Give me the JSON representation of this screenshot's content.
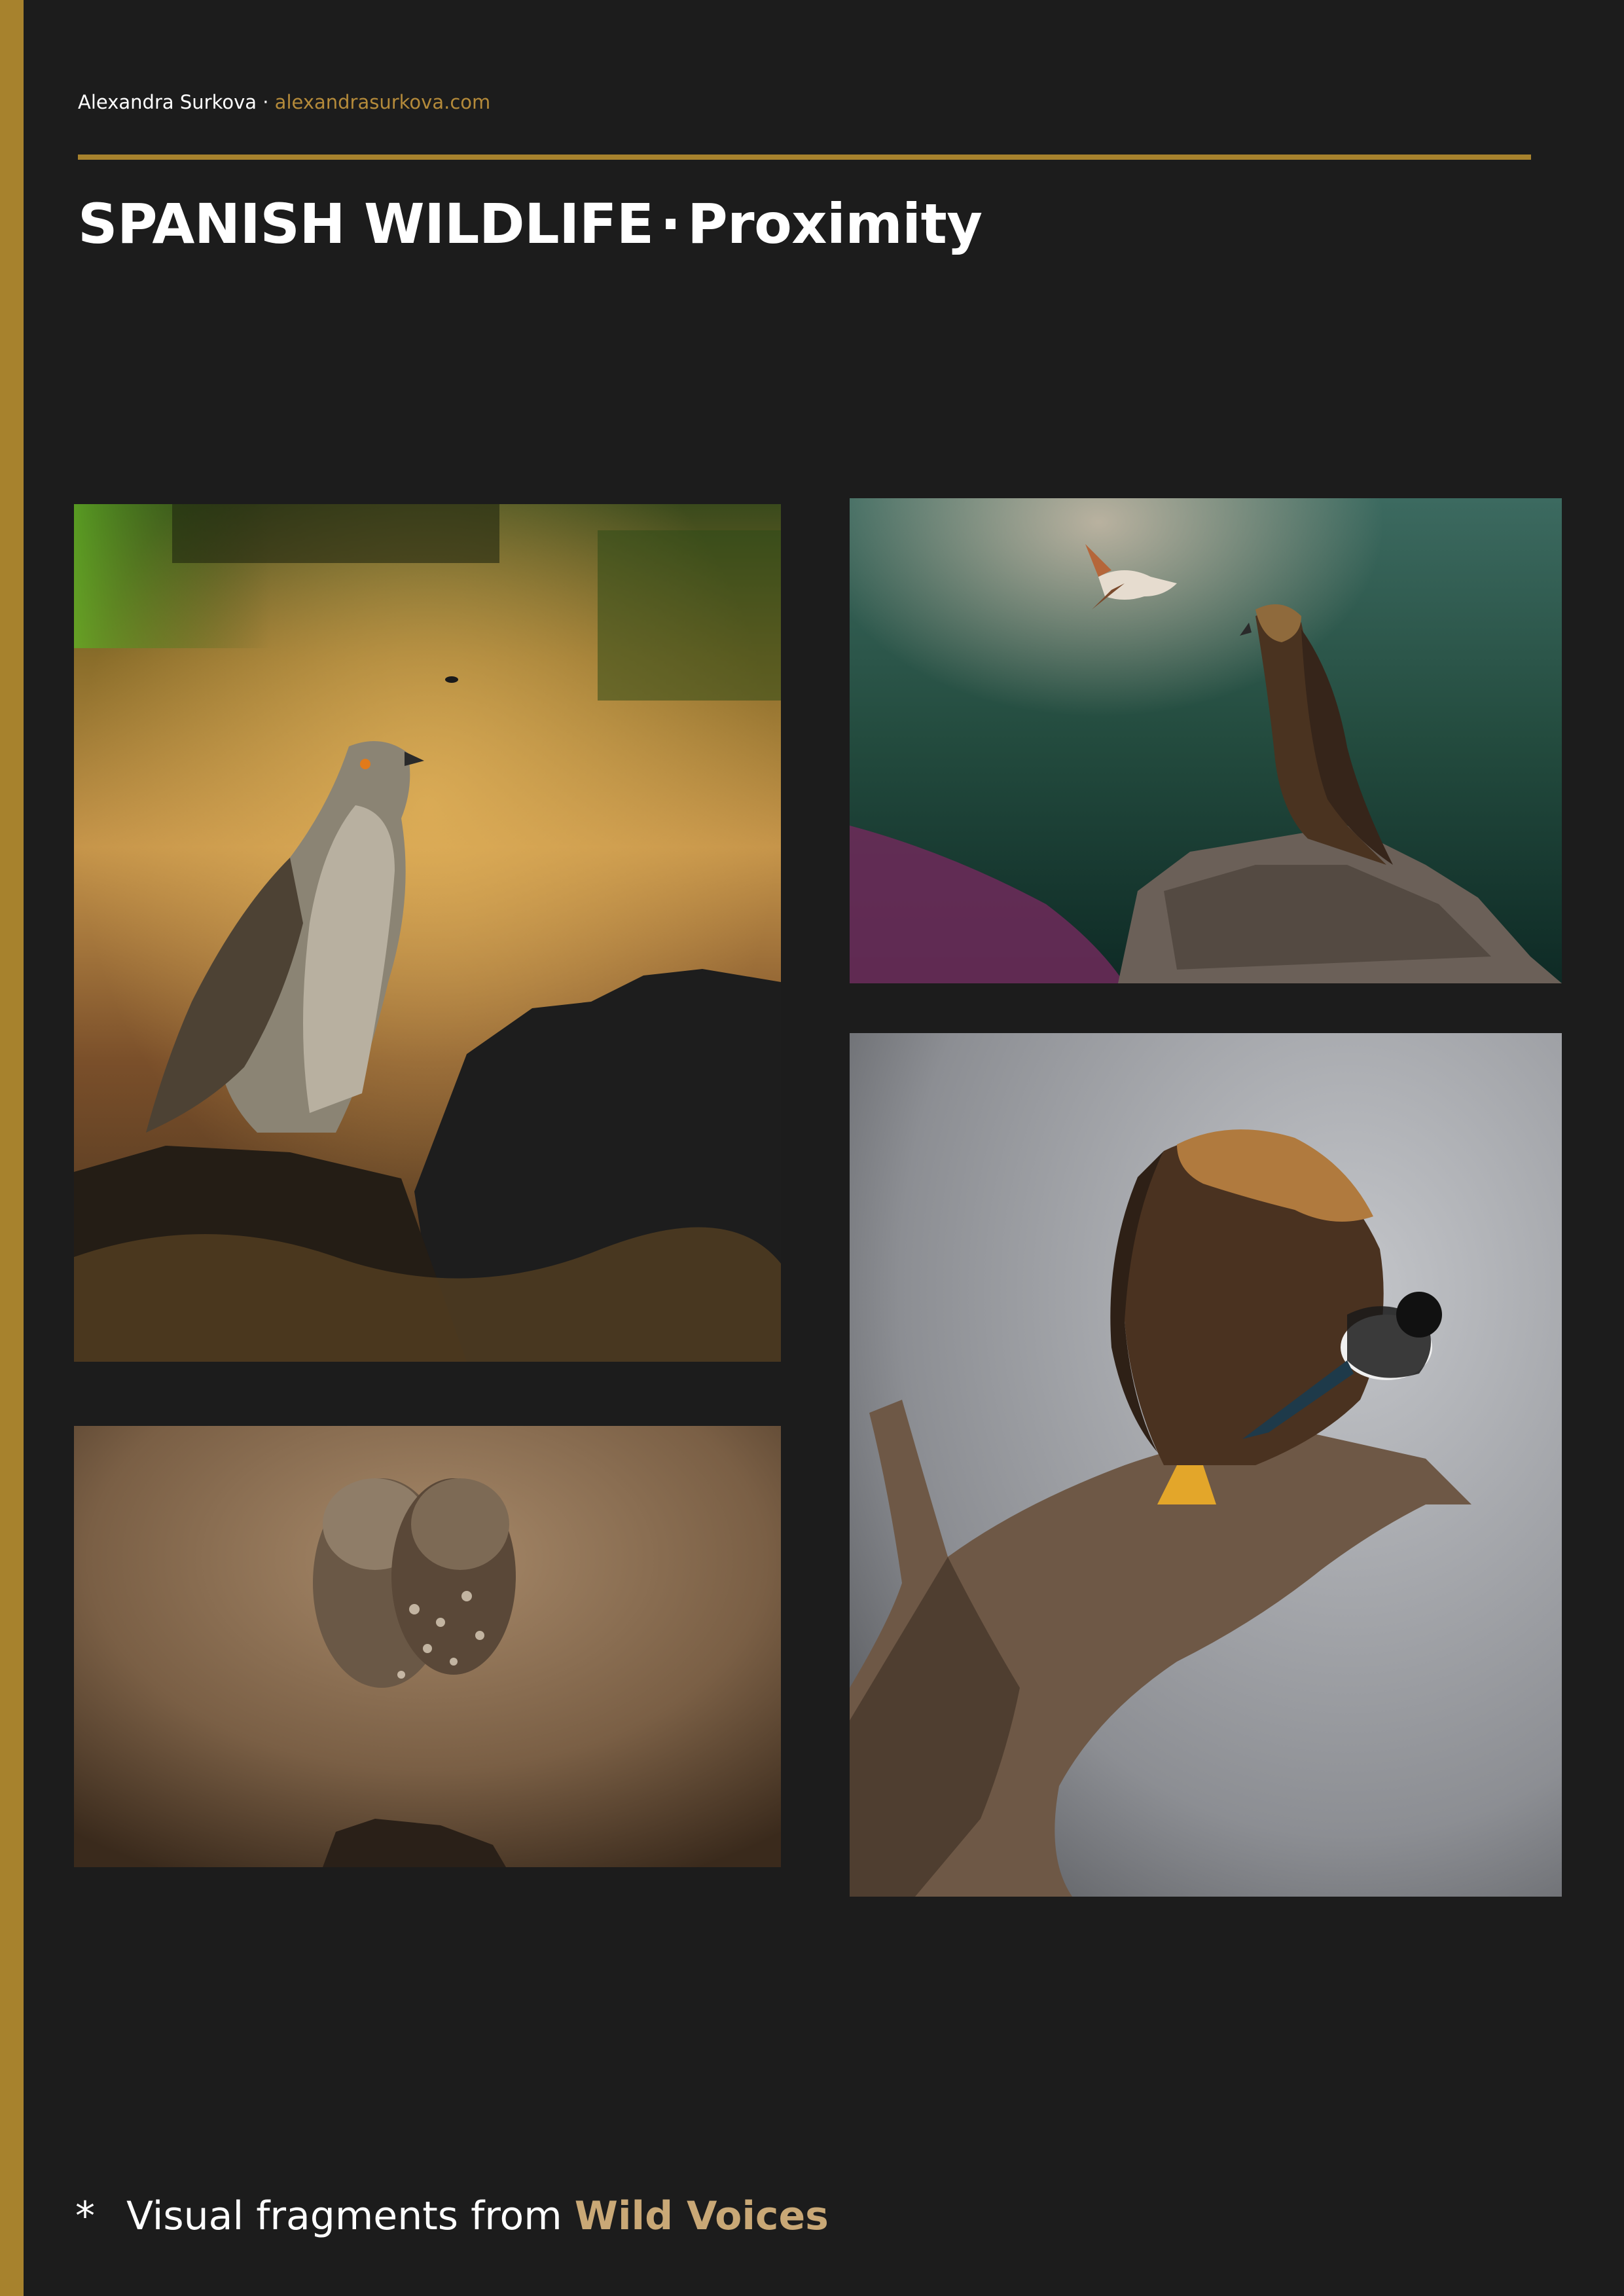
{
  "header": {
    "author": "Alexandra Surkova",
    "separator": "·",
    "website": "alexandrasurkova.com"
  },
  "title": {
    "main": "SPANISH WILDLIFE",
    "separator": "·",
    "sub": "Proximity"
  },
  "photos": [
    {
      "subject": "goshawk-on-rock",
      "scene": "Goshawk perched on dark rock against warm blurred grass"
    },
    {
      "subject": "golden-eagle-and-shrike",
      "scene": "Golden eagle on rock with a small bird in flight, teal background"
    },
    {
      "subject": "little-owls-pair",
      "scene": "Two little owls huddled together on a post, warm brown background"
    },
    {
      "subject": "golden-eagle-and-magpie",
      "scene": "Golden eagle and magpie on a twisted branch, grey background"
    }
  ],
  "footer": {
    "marker": "*",
    "text": "Visual fragments from",
    "highlight": "Wild Voices"
  },
  "colors": {
    "background": "#1c1c1c",
    "accent": "#a7822d",
    "link": "#b48a3a",
    "highlight": "#c9a876"
  }
}
